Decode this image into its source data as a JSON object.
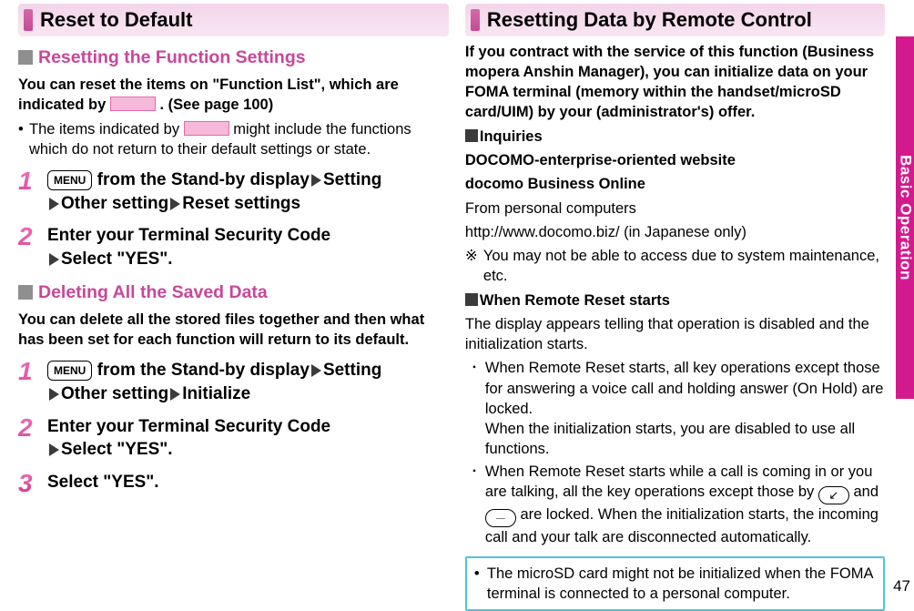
{
  "side_tab": "Basic Operation",
  "page_number": "47",
  "left": {
    "heading": "Reset to Default",
    "sec1": {
      "title": "Resetting the Function Settings",
      "intro_line1": "You can reset the items on \"Function List\", which are",
      "intro_line2a": "indicated by",
      "intro_line2b": ". (See page 100)",
      "bullet1a": "The items indicated by",
      "bullet1b": "might include the functions which do not return to their default settings or state.",
      "step1": {
        "menu": "MENU",
        "t1": "from the Stand-by display",
        "t2": "Setting",
        "t3": "Other setting",
        "t4": "Reset settings"
      },
      "step2": {
        "t1": "Enter your Terminal Security Code",
        "t2": "Select \"YES\"."
      }
    },
    "sec2": {
      "title": "Deleting All the Saved Data",
      "intro": "You can delete all the stored files together and then what has been set for each function will return to its default.",
      "step1": {
        "menu": "MENU",
        "t1": "from the Stand-by display",
        "t2": "Setting",
        "t3": "Other setting",
        "t4": "Initialize"
      },
      "step2": {
        "t1": "Enter your Terminal Security Code",
        "t2": "Select \"YES\"."
      },
      "step3": {
        "t1": "Select \"YES\"."
      }
    }
  },
  "right": {
    "heading": "Resetting Data by Remote Control",
    "intro": "If you contract with the service of this function (Business mopera Anshin Manager), you can initialize data on your FOMA terminal (memory within the handset/microSD card/UIM) by your (administrator's) offer.",
    "inq_label": "Inquiries",
    "inq1": "DOCOMO-enterprise-oriented website",
    "inq2": "docomo Business Online",
    "inq3": "From personal computers",
    "inq4": "http://www.docomo.biz/ (in Japanese only)",
    "kome": "You may not be able to access due to system maintenance, etc.",
    "when_label": "When Remote Reset starts",
    "when_text": "The display appears telling that operation is disabled and the initialization starts.",
    "note1": "When Remote Reset starts, all key operations except those for answering a voice call and holding answer (On Hold) are locked.",
    "note1b": "When the initialization starts, you are disabled to use all functions.",
    "note2a": "When Remote Reset starts while a call is coming in or you are talking, all the key operations except those by",
    "note2b": "and",
    "note2c": "are locked. When the initialization starts, the incoming call and your talk are disconnected automatically.",
    "box": "The microSD card might not be initialized when the FOMA terminal is connected to a personal computer."
  }
}
